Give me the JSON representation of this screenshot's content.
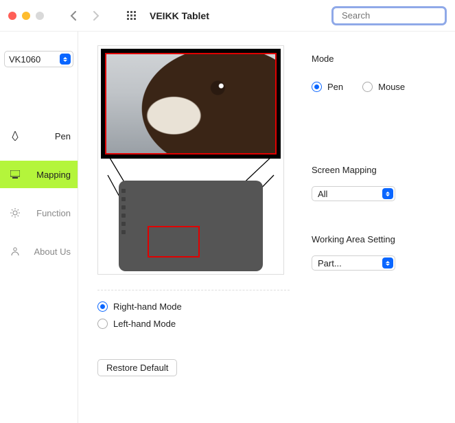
{
  "titlebar": {
    "app_title": "VEIKK Tablet",
    "search_placeholder": "Search"
  },
  "sidebar": {
    "device": "VK1060",
    "items": [
      {
        "label": "Pen"
      },
      {
        "label": "Mapping"
      },
      {
        "label": "Function"
      },
      {
        "label": "About Us"
      }
    ]
  },
  "mode": {
    "label": "Mode",
    "pen": "Pen",
    "mouse": "Mouse"
  },
  "screen_mapping": {
    "label": "Screen Mapping",
    "value": "All"
  },
  "working_area": {
    "label": "Working Area Setting",
    "value": "Part..."
  },
  "hand": {
    "right": "Right-hand Mode",
    "left": "Left-hand Mode"
  },
  "restore": "Restore Default"
}
